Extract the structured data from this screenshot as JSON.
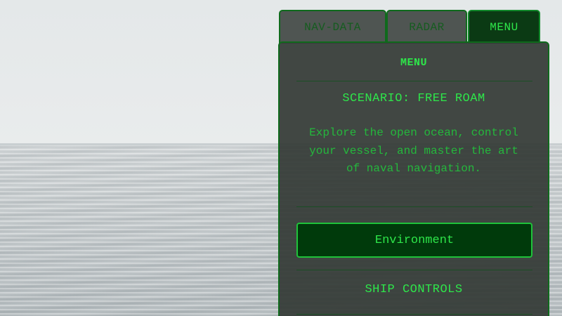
{
  "tabs": [
    {
      "label": "NAV-DATA",
      "active": false
    },
    {
      "label": "RADAR",
      "active": false
    },
    {
      "label": "MENU",
      "active": true
    }
  ],
  "panel": {
    "title": "MENU",
    "scenario_title": "SCENARIO: FREE ROAM",
    "scenario_description": "Explore the open ocean, control your vessel, and master the art of naval navigation.",
    "environment_button": "Environment",
    "ship_controls_label": "SHIP CONTROLS"
  },
  "colors": {
    "accent": "#2ee64a",
    "border": "#0f6a1c",
    "panel_bg": "#343a36",
    "button_bg": "#003a0b"
  }
}
